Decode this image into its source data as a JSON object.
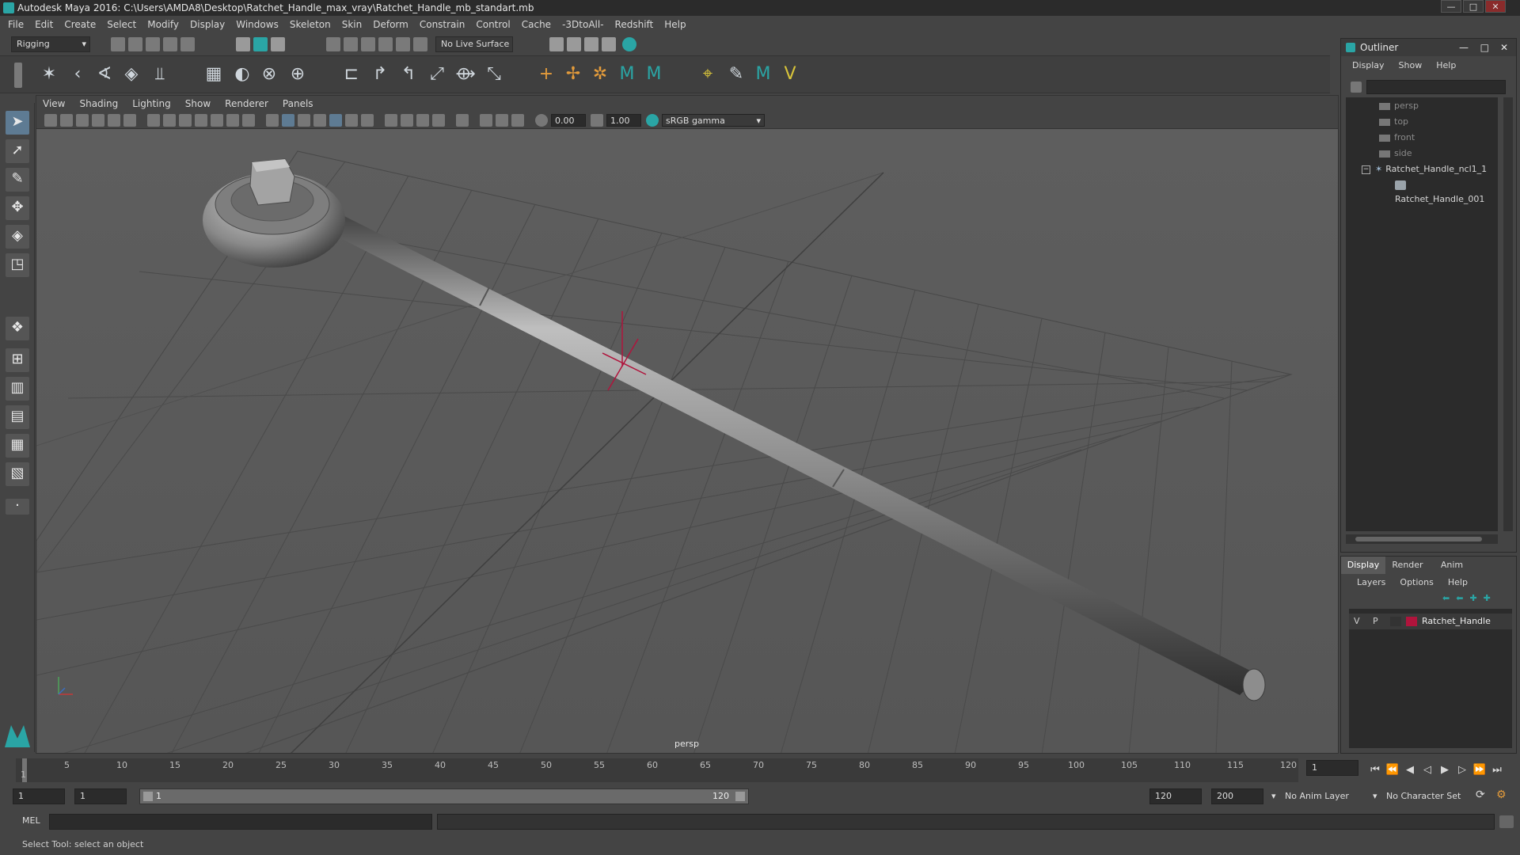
{
  "window": {
    "title": "Autodesk Maya 2016: C:\\Users\\AMDA8\\Desktop\\Ratchet_Handle_max_vray\\Ratchet_Handle_mb_standart.mb",
    "minimize": "—",
    "maximize": "□",
    "close": "✕"
  },
  "menubar": [
    "File",
    "Edit",
    "Create",
    "Select",
    "Modify",
    "Display",
    "Windows",
    "Skeleton",
    "Skin",
    "Deform",
    "Constrain",
    "Control",
    "Cache",
    "-3DtoAll-",
    "Redshift",
    "Help"
  ],
  "statusline": {
    "mode": "Rigging",
    "live_surface": "No Live Surface"
  },
  "viewport": {
    "menus": [
      "View",
      "Shading",
      "Lighting",
      "Show",
      "Renderer",
      "Panels"
    ],
    "exposure": "0.00",
    "gamma": "1.00",
    "color_space": "sRGB gamma",
    "camera_label": "persp"
  },
  "outliner": {
    "title": "Outliner",
    "menus": [
      "Display",
      "Show",
      "Help"
    ],
    "items": [
      {
        "label": "persp",
        "type": "camera"
      },
      {
        "label": "top",
        "type": "camera"
      },
      {
        "label": "front",
        "type": "camera"
      },
      {
        "label": "side",
        "type": "camera"
      },
      {
        "label": "Ratchet_Handle_ncl1_1",
        "type": "group"
      },
      {
        "label": "Ratchet_Handle_001",
        "type": "mesh"
      }
    ]
  },
  "layers": {
    "tabs": [
      "Display",
      "Render",
      "Anim"
    ],
    "menus": [
      "Layers",
      "Options",
      "Help"
    ],
    "row": {
      "v": "V",
      "p": "P",
      "name": "Ratchet_Handle",
      "color": "#b0143c"
    }
  },
  "timeline": {
    "ticks": [
      "1",
      "5",
      "10",
      "15",
      "20",
      "25",
      "30",
      "35",
      "40",
      "45",
      "50",
      "55",
      "60",
      "65",
      "70",
      "75",
      "80",
      "85",
      "90",
      "95",
      "100",
      "105",
      "110",
      "115",
      "120"
    ],
    "current_frame": "1"
  },
  "range": {
    "start": "1",
    "playback_start": "1",
    "slider_start": "1",
    "slider_end": "120",
    "playback_end": "120",
    "end": "200",
    "anim_layer": "No Anim Layer",
    "character_set": "No Character Set"
  },
  "command": {
    "lang": "MEL"
  },
  "helpline": "Select Tool: select an object",
  "colors": {
    "accent": "#2aa5a5",
    "background": "#444444",
    "viewport": "#5a5a5a"
  }
}
